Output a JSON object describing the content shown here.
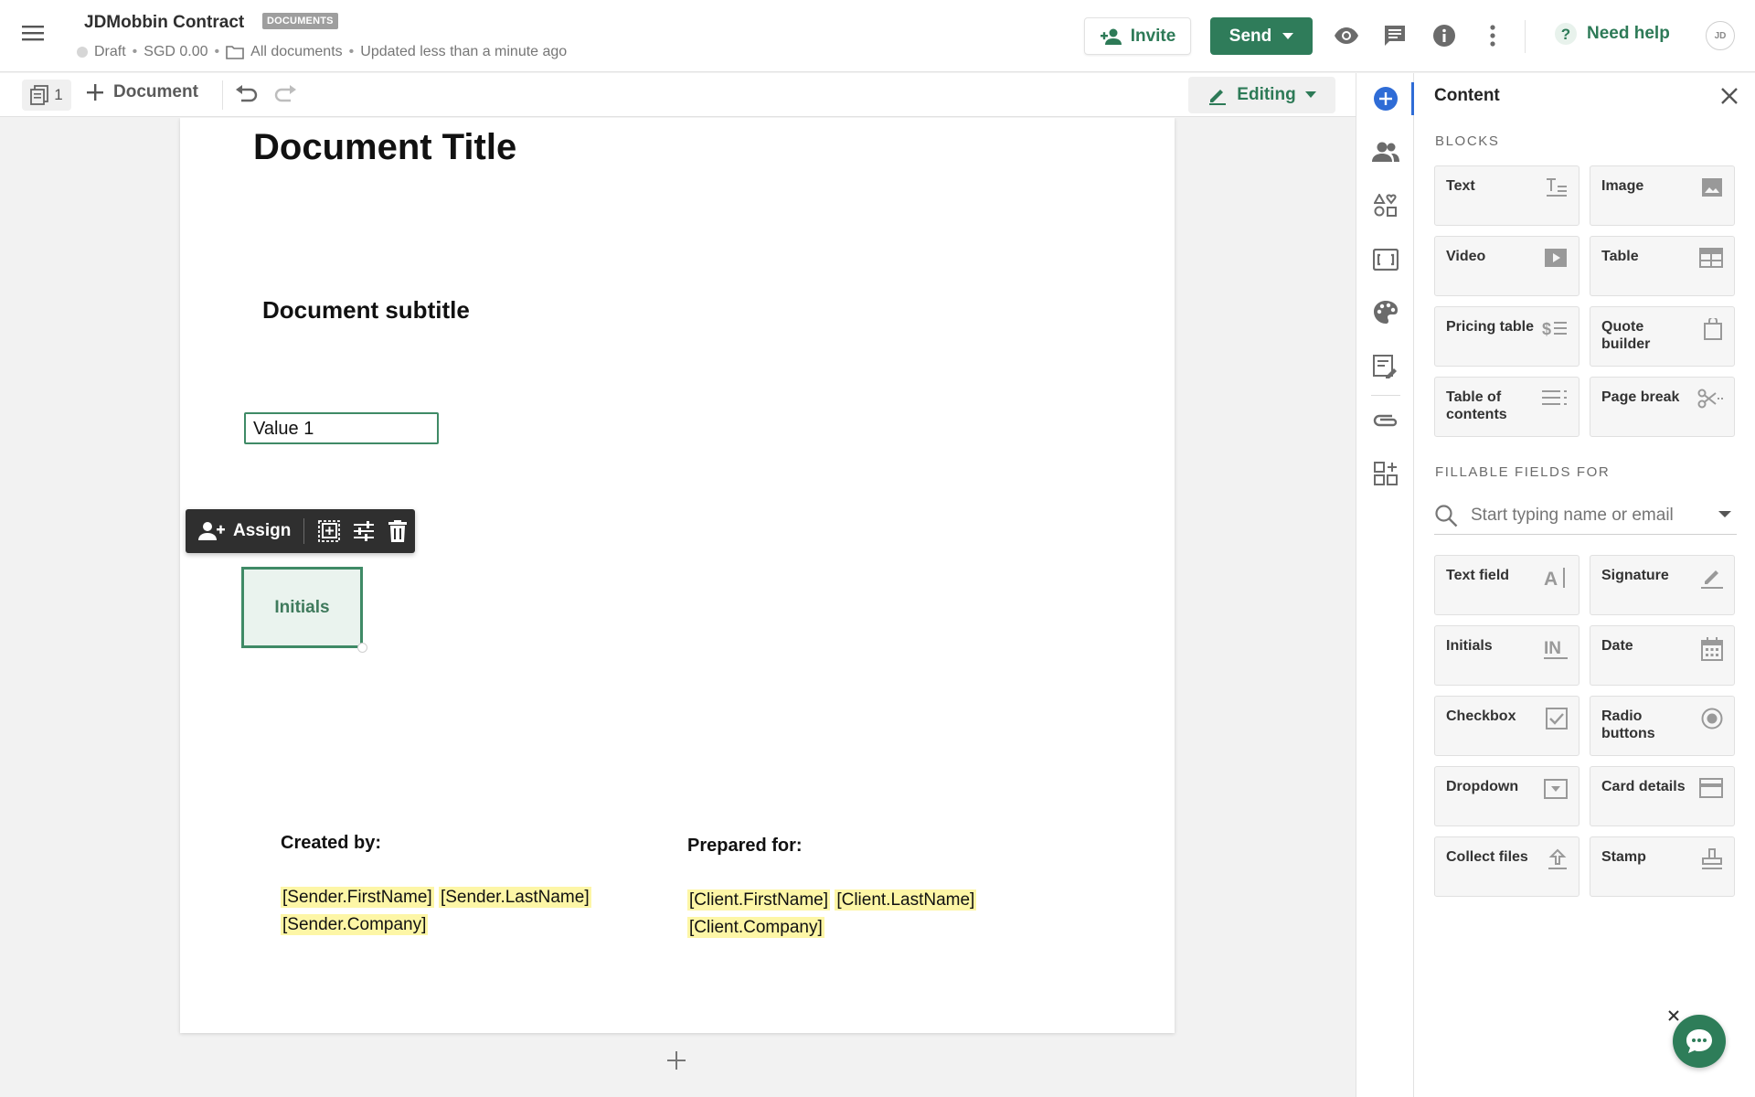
{
  "header": {
    "doc_name": "JDMobbin Contract",
    "badge": "DOCUMENTS",
    "status": "Draft",
    "amount": "SGD 0.00",
    "folder": "All documents",
    "updated": "Updated less than a minute ago",
    "invite_label": "Invite",
    "send_label": "Send",
    "help_label": "Need help",
    "avatar_initials": "JD"
  },
  "toolbar": {
    "page_count": "1",
    "add_document_label": "Document",
    "mode_label": "Editing"
  },
  "document": {
    "title": "Document Title",
    "subtitle": "Document subtitle",
    "value_field": "Value 1",
    "assign_label": "Assign",
    "initials_label": "Initials",
    "created_by_label": "Created by:",
    "prepared_for_label": "Prepared for:",
    "sender_tokens": [
      "[Sender.FirstName]",
      "[Sender.LastName]",
      "[Sender.Company]"
    ],
    "client_tokens": [
      "[Client.FirstName]",
      "[Client.LastName]",
      "[Client.Company]"
    ]
  },
  "panel": {
    "title": "Content",
    "blocks_label": "BLOCKS",
    "blocks": [
      {
        "label": "Text",
        "icon": "text-block-icon"
      },
      {
        "label": "Image",
        "icon": "image-icon"
      },
      {
        "label": "Video",
        "icon": "video-icon"
      },
      {
        "label": "Table",
        "icon": "table-icon"
      },
      {
        "label": "Pricing table",
        "icon": "pricing-table-icon"
      },
      {
        "label": "Quote builder",
        "icon": "quote-builder-icon"
      },
      {
        "label": "Table of contents",
        "icon": "table-of-contents-icon"
      },
      {
        "label": "Page break",
        "icon": "page-break-icon"
      }
    ],
    "fields_label": "FILLABLE FIELDS FOR",
    "search_placeholder": "Start typing name or email",
    "fields": [
      {
        "label": "Text field",
        "icon": "text-field-icon"
      },
      {
        "label": "Signature",
        "icon": "signature-icon"
      },
      {
        "label": "Initials",
        "icon": "initials-icon"
      },
      {
        "label": "Date",
        "icon": "date-icon"
      },
      {
        "label": "Checkbox",
        "icon": "checkbox-icon"
      },
      {
        "label": "Radio buttons",
        "icon": "radio-buttons-icon"
      },
      {
        "label": "Dropdown",
        "icon": "dropdown-icon"
      },
      {
        "label": "Card details",
        "icon": "card-details-icon"
      },
      {
        "label": "Collect files",
        "icon": "collect-files-icon"
      },
      {
        "label": "Stamp",
        "icon": "stamp-icon"
      }
    ]
  },
  "colors": {
    "brand_green": "#2f7c5a",
    "accent_blue": "#2f6cd6",
    "token_highlight": "#fdf6a6"
  }
}
